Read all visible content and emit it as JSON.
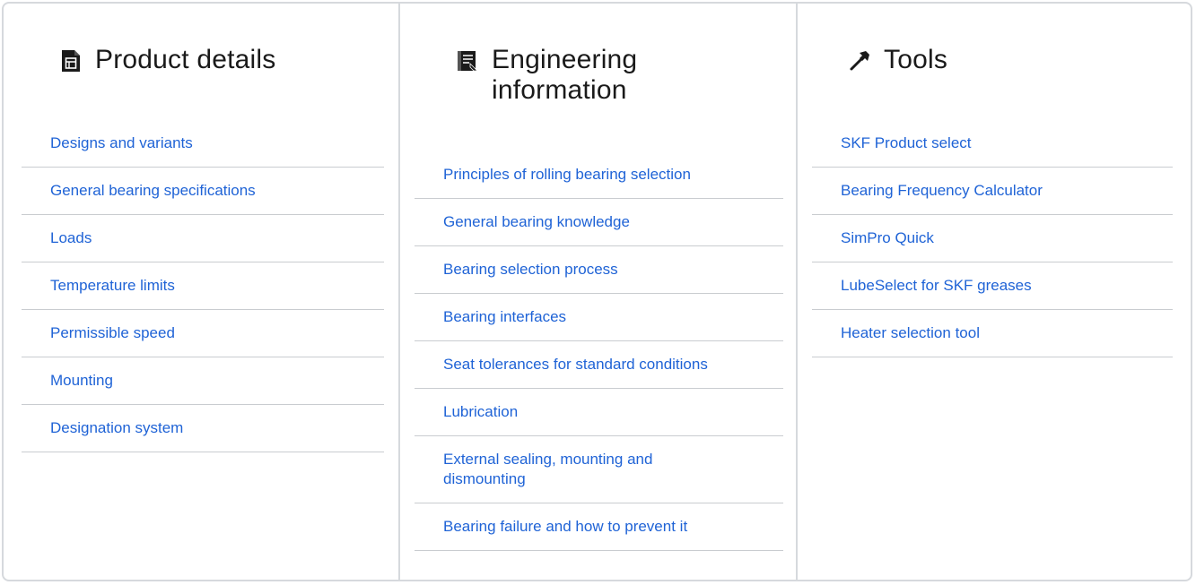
{
  "columns": {
    "product_details": {
      "title": "Product details",
      "icon": "product-sheet-icon",
      "links": [
        "Designs and variants",
        "General bearing specifications",
        "Loads",
        "Temperature limits",
        "Permissible speed",
        "Mounting",
        "Designation system"
      ]
    },
    "engineering_information": {
      "title": "Engineering information",
      "icon": "engineering-book-icon",
      "links": [
        "Principles of rolling bearing selection",
        "General bearing knowledge",
        "Bearing selection process",
        "Bearing interfaces",
        "Seat tolerances for standard conditions",
        "Lubrication",
        "External sealing, mounting and dismounting",
        "Bearing failure and how to prevent it"
      ]
    },
    "tools": {
      "title": "Tools",
      "icon": "hammer-icon",
      "links": [
        "SKF Product select",
        "Bearing Frequency Calculator",
        "SimPro Quick",
        "LubeSelect for SKF greases",
        "Heater selection tool"
      ]
    }
  },
  "colors": {
    "link": "#1f63d6",
    "divider": "#c9ccd0",
    "border": "#d6d9dd",
    "text": "#1a1a1a"
  }
}
